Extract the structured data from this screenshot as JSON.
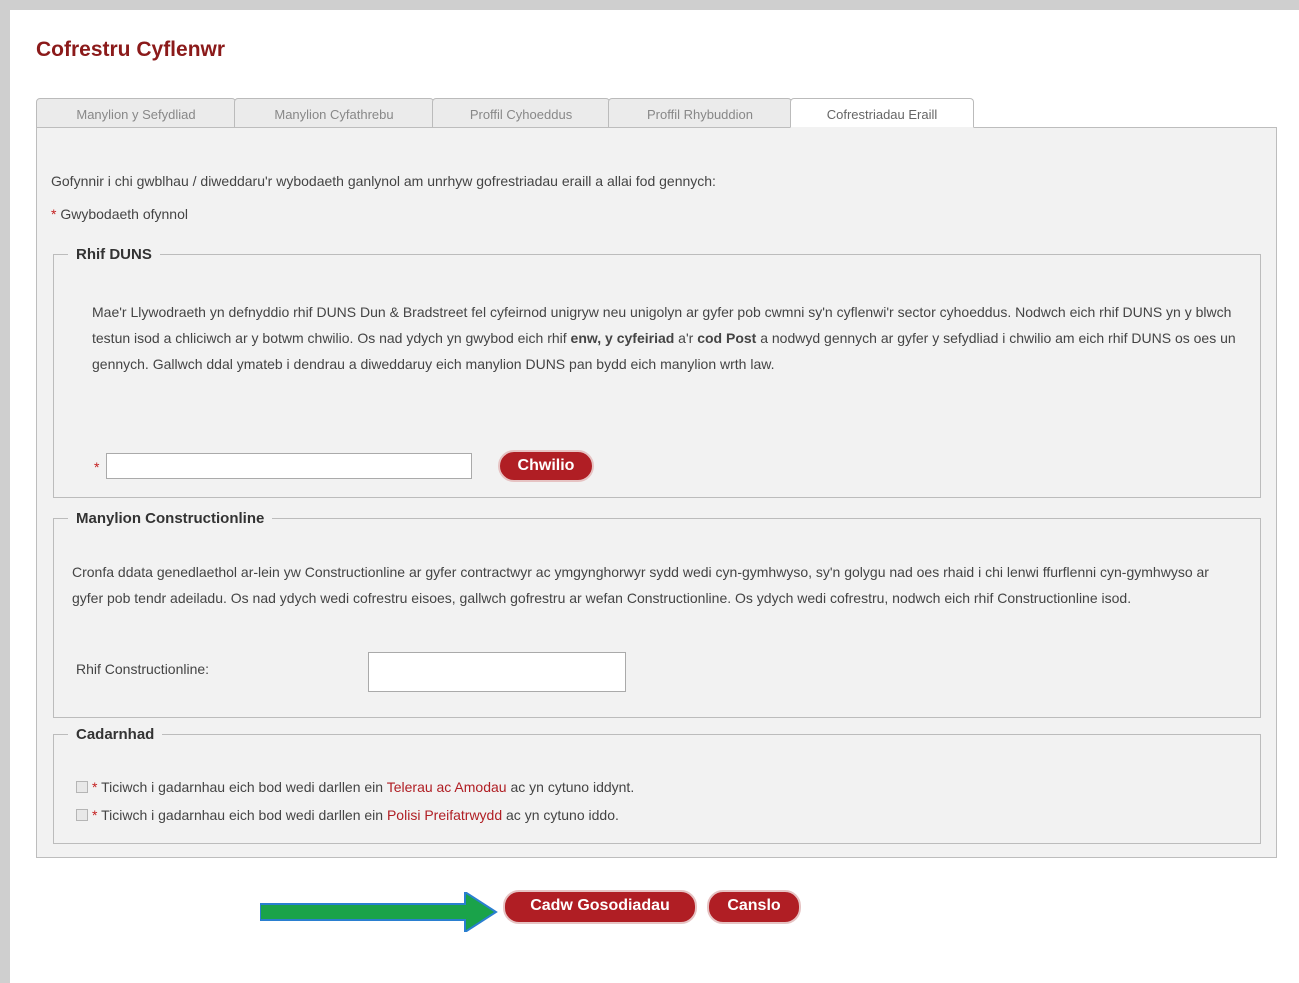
{
  "page_title": "Cofrestru Cyflenwr",
  "tabs": [
    {
      "label": "Manylion y Sefydliad"
    },
    {
      "label": "Manylion Cyfathrebu"
    },
    {
      "label": "Proffil Cyhoeddus"
    },
    {
      "label": "Proffil Rhybuddion"
    },
    {
      "label": "Cofrestriadau Eraill"
    }
  ],
  "intro": "Gofynnir i chi gwblhau / diweddaru'r wybodaeth ganlynol am unrhyw gofrestriadau eraill a allai fod gennych:",
  "required_marker": "*",
  "required_note": "Gwybodaeth ofynnol",
  "duns": {
    "legend": "Rhif DUNS",
    "para_1": "Mae'r Llywodraeth yn defnyddio rhif DUNS Dun & Bradstreet fel cyfeirnod unigryw neu unigolyn ar gyfer pob cwmni sy'n cyflenwi'r sector cyhoeddus. Nodwch eich rhif DUNS yn y blwch testun isod a chliciwch ar y botwm chwilio. Os nad ydych yn gwybod eich rhif ",
    "bold_1": "enw, y cyfeiriad",
    "para_2": " a'r ",
    "bold_2": "cod Post",
    "para_3": " a nodwyd gennych ar gyfer y sefydliad i chwilio am eich rhif DUNS os oes un gennych. Gallwch ddal ymateb i dendrau a diweddaruy eich manylion DUNS pan bydd eich manylion wrth law.",
    "input_value": "",
    "search_label": "Chwilio"
  },
  "constructionline": {
    "legend": "Manylion Constructionline",
    "para": "Cronfa ddata genedlaethol ar-lein yw Constructionline ar gyfer contractwyr ac ymgynghorwyr sydd wedi cyn-gymhwyso, sy'n golygu nad oes rhaid i chi lenwi ffurflenni cyn-gymhwyso ar gyfer pob tendr adeiladu. Os nad ydych wedi cofrestru eisoes, gallwch gofrestru ar wefan Constructionline. Os ydych wedi cofrestru, nodwch eich rhif Constructionline isod.",
    "field_label": "Rhif Constructionline:",
    "input_value": ""
  },
  "confirmation": {
    "legend": "Cadarnhad",
    "terms_prefix": "Ticiwch i gadarnhau eich bod wedi darllen ein",
    "terms_link": "Telerau ac Amodau",
    "terms_suffix": "ac yn cytuno iddynt.",
    "privacy_prefix": "Ticiwch i gadarnhau eich bod wedi darllen ein",
    "privacy_link": "Polisi Preifatrwydd",
    "privacy_suffix": "ac yn cytuno iddo."
  },
  "actions": {
    "save_label": "Cadw Gosodiadau",
    "cancel_label": "Canslo"
  },
  "colors": {
    "brand": "#b01e24",
    "title": "#8b1a1a",
    "arrow": "#1aa34a"
  }
}
